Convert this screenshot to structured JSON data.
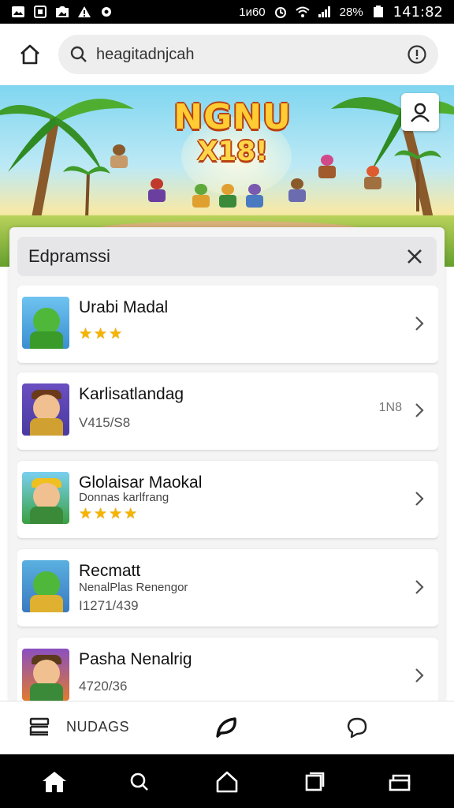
{
  "status_bar": {
    "left_icons": [
      "image-icon",
      "sim-icon",
      "photo-icon",
      "warning-icon",
      "gear-icon"
    ],
    "carrier_text": "1ᴎ60",
    "alarm_icon": "alarm-icon",
    "wifi_icon": "wifi-icon",
    "signal_icon": "signal-icon",
    "battery_text": "28%",
    "battery_icon": "battery-icon",
    "time": "141:82"
  },
  "top_bar": {
    "home_icon": "home-icon",
    "search": {
      "value": "heagitadnjcah",
      "icon": "search-icon"
    },
    "info_icon": "info-icon"
  },
  "banner": {
    "title_line1": "NGNU",
    "title_line2": "X18!",
    "profile_icon": "user-icon"
  },
  "panel": {
    "title": "Edpramssi",
    "close_icon": "close-icon",
    "items": [
      {
        "title": "Urabi Madal",
        "rating": 3,
        "subtitle": "",
        "meta": "",
        "badge": ""
      },
      {
        "title": "Karlisatlandag",
        "rating": 0,
        "subtitle": "",
        "meta": "V415/S8",
        "badge": "1N8"
      },
      {
        "title": "Glolaisar Maokal",
        "rating": 4,
        "subtitle": "Donnas karlfrang",
        "meta": "",
        "badge": ""
      },
      {
        "title": "Recmatt",
        "rating": 0,
        "subtitle": "NenalPlas Renengor",
        "meta": "I1271/439",
        "badge": ""
      },
      {
        "title": "Pasha Nenalrig",
        "rating": 0,
        "subtitle": "",
        "meta": "4720/36",
        "badge": ""
      }
    ]
  },
  "bottom_bar": {
    "left_label": "NUDAGS",
    "left_icon": "stack-icon",
    "center_icon": "chat-leaf-icon",
    "right_icon": "speech-bubble-icon"
  },
  "nav_bar": {
    "icons": [
      "home-icon",
      "search-icon",
      "home-outline-icon",
      "square-icon",
      "layers-icon"
    ]
  },
  "colors": {
    "accent_star": "#f5b400",
    "nav_background": "#000000",
    "search_background": "#eeeeef"
  }
}
